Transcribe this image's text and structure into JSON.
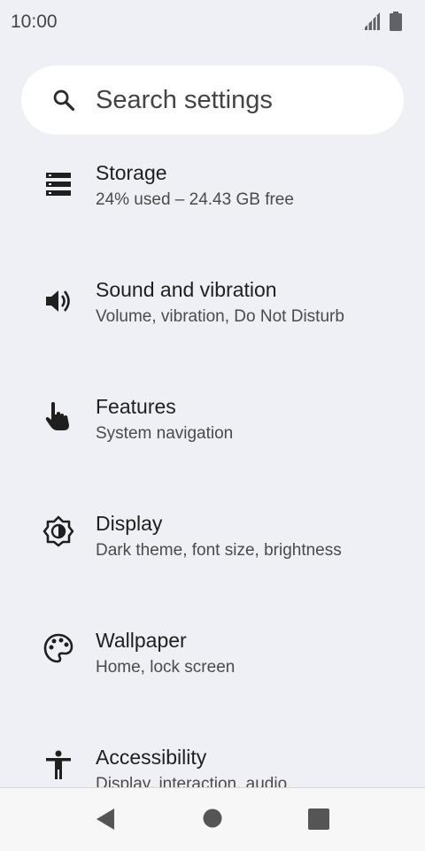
{
  "status_bar": {
    "time": "10:00",
    "icons": [
      "signal-icon",
      "battery-icon"
    ]
  },
  "search": {
    "placeholder": "Search settings",
    "icon": "search-icon"
  },
  "settings": [
    {
      "title": "Storage",
      "subtitle": "24% used – 24.43 GB free",
      "icon": "storage-icon"
    },
    {
      "title": "Sound and vibration",
      "subtitle": "Volume, vibration, Do Not Disturb",
      "icon": "volume-icon"
    },
    {
      "title": "Features",
      "subtitle": "System navigation",
      "icon": "gesture-hand-icon"
    },
    {
      "title": "Display",
      "subtitle": "Dark theme, font size, brightness",
      "icon": "brightness-icon"
    },
    {
      "title": "Wallpaper",
      "subtitle": "Home, lock screen",
      "icon": "palette-icon"
    },
    {
      "title": "Accessibility",
      "subtitle": "Display, interaction, audio",
      "icon": "accessibility-icon"
    }
  ],
  "nav_bar": {
    "buttons": [
      "back-icon",
      "home-icon",
      "recents-icon"
    ]
  },
  "colors": {
    "background": "#eef0f5",
    "card": "#ffffff",
    "icon": "#1f1f1f"
  }
}
